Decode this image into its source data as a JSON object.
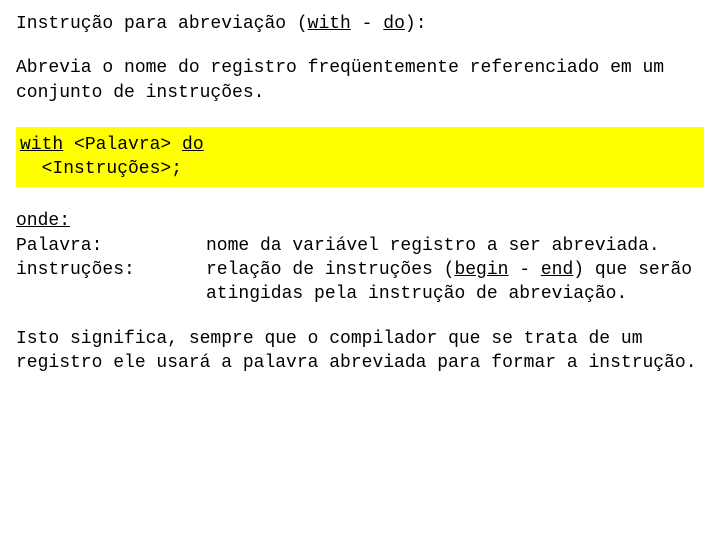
{
  "heading": {
    "pre": "Instrução para abreviação (",
    "kw1": "with",
    "mid": " - ",
    "kw2": "do",
    "post": "):"
  },
  "intro": "Abrevia o nome do registro freqüentemente referenciado em um conjunto de instruções.",
  "syntax": {
    "l1a": "with",
    "l1b": " <Palavra> ",
    "l1c": "do",
    "l2": "<Instruções>;"
  },
  "onde_label": "onde:",
  "defs": {
    "palavra_term": "Palavra:",
    "palavra_desc": "nome da variável registro a ser abreviada.",
    "instrucoes_term": "instruções:",
    "instrucoes_desc_a": "relação de instruções (",
    "instrucoes_desc_begin": "begin",
    "instrucoes_desc_b": " - ",
    "instrucoes_desc_end": "end",
    "instrucoes_desc_c": ") que serão atingidas pela instrução de abreviação."
  },
  "footer": "Isto significa, sempre que o compilador que se trata de um registro ele usará a palavra abreviada para formar a instrução."
}
